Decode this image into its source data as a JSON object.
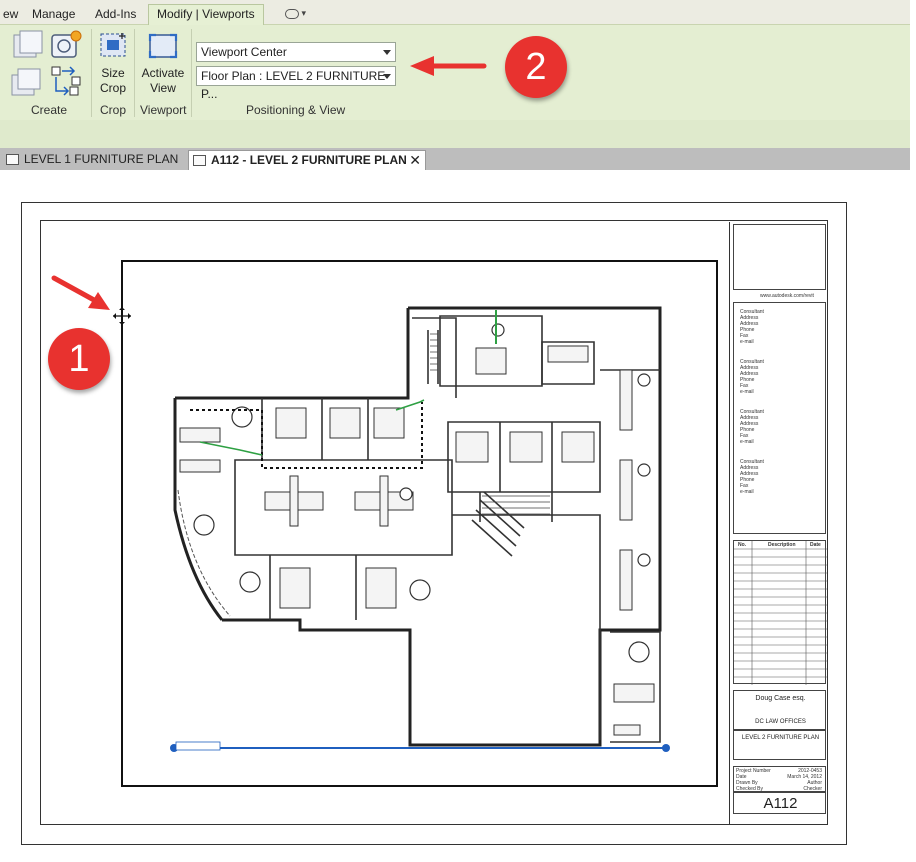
{
  "ribbon_tabs": [
    {
      "label": "ew"
    },
    {
      "label": "Manage"
    },
    {
      "label": "Add-Ins"
    },
    {
      "label": "Modify | Viewports",
      "active": true
    }
  ],
  "ribbon": {
    "create_label": "Create",
    "size_crop_line1": "Size",
    "size_crop_line2": "Crop",
    "crop_label": "Crop",
    "activate_view_line1": "Activate",
    "activate_view_line2": "View",
    "viewport_label": "Viewport",
    "positioning_label": "Positioning & View",
    "viewport_position_select": "Viewport Center",
    "view_select": "Floor Plan : LEVEL 2 FURNITURE P..."
  },
  "annotations": {
    "badge_1": "1",
    "badge_2": "2",
    "accent_color": "#e8322f"
  },
  "view_tabs": [
    {
      "label": "LEVEL 1 FURNITURE PLAN"
    },
    {
      "label": "A112 - LEVEL 2 FURNITURE PLAN",
      "active": true,
      "close": "✕"
    }
  ],
  "title_block": {
    "client": "Doug Case esq.",
    "project": "DC LAW OFFICES",
    "sheet_title": "LEVEL 2 FURNITURE PLAN",
    "project_number": "2012-0453",
    "date": "March 14, 2012",
    "drawn_by": "Author",
    "checked_by": "Checker",
    "sheet_number": "A112",
    "revision_headers": [
      "No.",
      "Description",
      "Date"
    ],
    "row_labels": [
      "Project Number",
      "Date",
      "Drawn By",
      "Checked By"
    ],
    "consultant_label": "Consultant",
    "consultant_fields": [
      "Address",
      "Address",
      "Phone",
      "Fax",
      "e-mail"
    ],
    "website": "www.autodesk.com/revit"
  }
}
